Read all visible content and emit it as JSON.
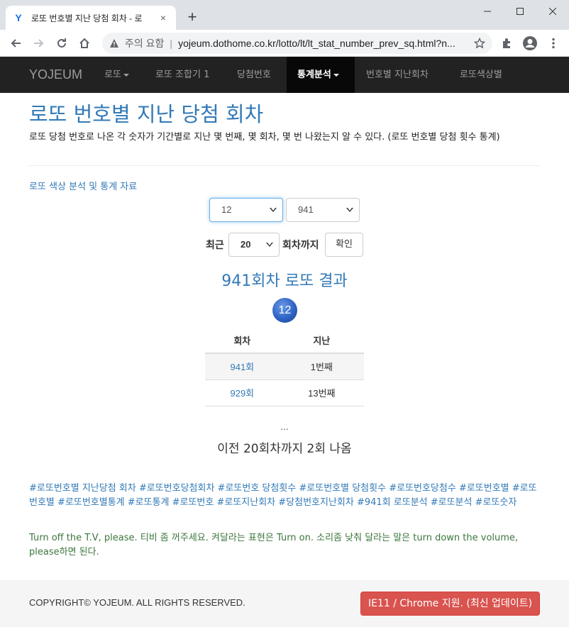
{
  "browser": {
    "tab_title": "로또 번호별 지난 당첨 회차 - 로",
    "tab_favicon": "Y",
    "close_glyph": "×",
    "newtab_glyph": "+",
    "security_label": "주의 요함",
    "url_separator": "|",
    "url": "yojeum.dothome.co.kr/lotto/lt/lt_stat_number_prev_sq.html?n..."
  },
  "navbar": {
    "brand": "YOJEUM",
    "items": [
      {
        "label": "로또",
        "dropdown": true,
        "active": false
      },
      {
        "label": "로또 조합기 1",
        "dropdown": false,
        "active": false
      },
      {
        "label": "당첨번호",
        "dropdown": false,
        "active": false
      },
      {
        "label": "통계분석",
        "dropdown": true,
        "active": true
      },
      {
        "label": "번호별 지난회차",
        "dropdown": false,
        "active": false
      },
      {
        "label": "로또색상별",
        "dropdown": false,
        "active": false
      }
    ]
  },
  "page": {
    "title": "로또 번호별 지난 당첨 회차",
    "description": "로또 당첨 번호로 나온 각 숫자가 기간별로 지난 몇 번째, 몇 회차, 몇 번 나왔는지 알 수 있다. (로또 번호별 당첨 횟수 통계)",
    "color_link": "로또 색상 분석 및 통계 자료"
  },
  "form": {
    "number_select": "12",
    "round_select": "941",
    "recent_label": "최근",
    "recent_select": "20",
    "until_label": "회차까지",
    "confirm_button": "확인"
  },
  "result": {
    "title": "941회차 로또 결과",
    "ball_number": "12",
    "headers": [
      "회차",
      "지난"
    ],
    "rows": [
      {
        "round": "941회",
        "ago": "1번째"
      },
      {
        "round": "929회",
        "ago": "13번째"
      }
    ],
    "ellipsis": "...",
    "summary": "이전 20회차까지 2회 나옴"
  },
  "tags": "#로또번호별 지난당첨 회차 #로또번호당첨회차 #로또번호 당첨횟수 #로또번호별 당첨횟수 #로또번호당첨수 #로또번호별 #로또번호별 #로또번호별통계 #로또통계 #로또번호 #로또지난회차 #당첨번호지난회차 #941회 로또분석 #로또분석 #로또숫자",
  "note": "Turn off the T.V, please. 티비 좀 꺼주세요. 켜달라는 표현은 Turn on. 소리좀 낮춰 달라는 말은 turn down the volume, please하면 된다.",
  "footer": {
    "copyright": "COPYRIGHT© YOJEUM. ALL RIGHTS RESERVED.",
    "ie_button": "IE11 / Chrome 지원. (최신 업데이트)"
  },
  "colors": {
    "link": "#337ab7",
    "navbar_bg": "#222222",
    "ball": "#2f63c4",
    "note": "#3c763d",
    "danger": "#d9534f"
  },
  "icons": [
    "favicon-icon",
    "close-icon",
    "plus-icon",
    "minimize-icon",
    "maximize-icon",
    "window-close-icon",
    "back-icon",
    "forward-icon",
    "reload-icon",
    "home-icon",
    "warning-icon",
    "star-icon",
    "extensions-icon",
    "profile-icon",
    "menu-icon"
  ]
}
